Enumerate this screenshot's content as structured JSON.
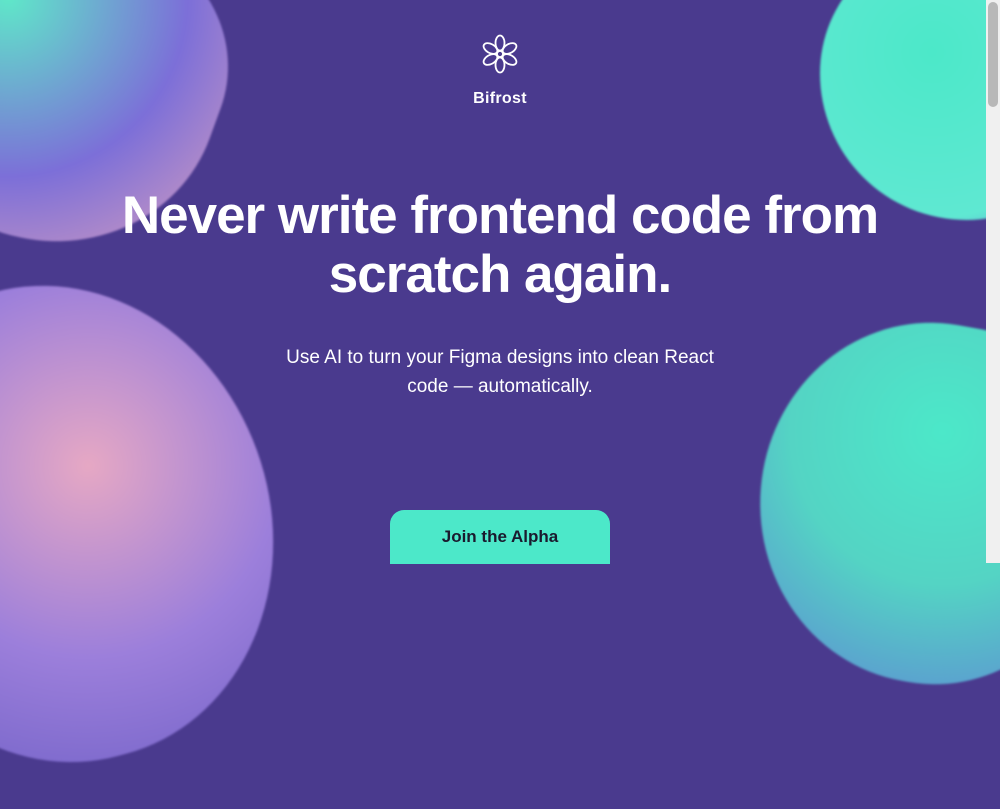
{
  "brand": {
    "name": "Bifrost"
  },
  "hero": {
    "headline": "Never write frontend code from scratch again.",
    "subheadline": "Use AI to turn your Figma designs into clean React code — automatically."
  },
  "cta": {
    "label": "Join the Alpha"
  },
  "colors": {
    "background": "#4a3a8e",
    "accent": "#4ce8c9",
    "text": "#ffffff"
  }
}
